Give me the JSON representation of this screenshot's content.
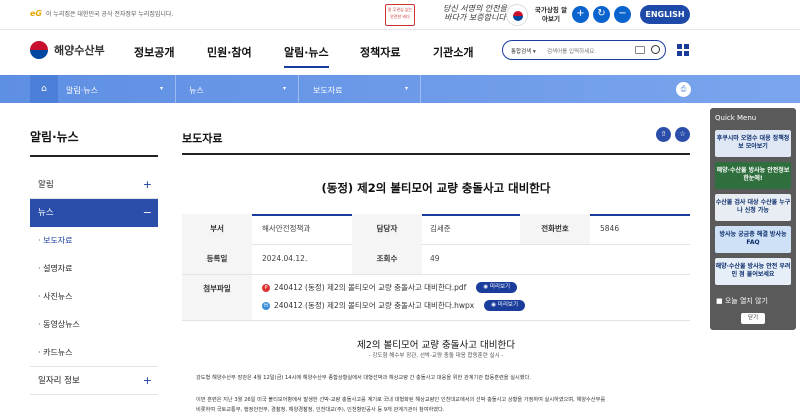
{
  "topbar": {
    "gov_logo": "eG",
    "gov_notice": "이 누리집은 대한민국 공식 전자정부 누리집입니다.",
    "banner_text": "말 무관심 없는 안전한 바다",
    "slogan": "당신 서명의 안전을 바다가 보증합니다",
    "flag_label": "국가상징 알아보기",
    "english_label": "ENGLISH"
  },
  "header": {
    "org_name": "해양수산부",
    "nav": [
      "정보공개",
      "민원·참여",
      "알림·뉴스",
      "정책자료",
      "기관소개"
    ],
    "search_scope": "통합검색 ▾",
    "search_placeholder": "검색어를 입력하세요."
  },
  "breadcrumb": {
    "home_icon": "home-icon",
    "items": [
      "알림·뉴스",
      "뉴스",
      "보도자료"
    ]
  },
  "lnb": {
    "title": "알림·뉴스",
    "items": [
      {
        "label": "알림",
        "toggle": "+"
      },
      {
        "label": "뉴스",
        "toggle": "−"
      }
    ],
    "subitems": [
      "· 보도자료",
      "· 설명자료",
      "· 사진뉴스",
      "· 동영상뉴스",
      "· 카드뉴스"
    ],
    "items_after": [
      {
        "label": "일자리 정보",
        "toggle": "+"
      }
    ]
  },
  "main": {
    "title": "보도자료",
    "article_title": "(동정) 제2의 볼티모어 교량 충돌사고 대비한다",
    "info_rows": [
      {
        "l1": "부서",
        "v1": "해사안전정책과",
        "l2": "담당자",
        "v2": "김세준",
        "l3": "전화번호",
        "v3": "5846"
      },
      {
        "l1": "등록일",
        "v1": "2024.04.12.",
        "l2": "조회수",
        "v2": "49",
        "l3": "",
        "v3": ""
      }
    ],
    "attach_label": "첨부파일",
    "files": [
      {
        "name": "240412 (동정) 제2의 볼티모어 교량 충돌사고 대비한다.pdf",
        "preview": "◉ 미리보기",
        "color": "#d33"
      },
      {
        "name": "240412 (동정) 제2의 볼티모어 교량 충돌사고 대비한다.hwpx",
        "preview": "◉ 미리보기",
        "color": "#3a8ed8"
      }
    ],
    "body_title": "제2의 볼티모어 교량 충돌사고 대비한다",
    "body_subtitle": "- 강도형 해수부 장관, 선박-교량 충돌 대응 합동훈련 실시 -",
    "paragraphs": [
      "강도형 해양수산부 장관은 4월 12일(금) 14시에 해양수산부 종합상황실에서 대형선박과 해상교량 간 충돌사고 대응을 위한 관계기관 합동훈련을 실시했다.",
      "이번 훈련은 지난 3월 26일 미국 볼티모어항에서 발생한 선박-교량 충돌사고를 계기로 국내 대형화된 해상교량인 인천대교에서의 선박 충돌사고 상황을 가정하여 실시하였으며, 해양수산부를",
      "비롯하여 국토교통부, 행정안전부, 경찰청, 해양경찰청, 인천대교(주), 인천항만공사 등 9개 관계기관이 참여하였다."
    ]
  },
  "quick_menu": {
    "title": "Quick Menu",
    "cards": [
      {
        "text": "후쿠시마 오염수 대응 정책정보 모아보기",
        "bg": "#dfe7f5"
      },
      {
        "text": "해양·수산물 방사능 안전정보 한눈에!",
        "bg": "#2f6f3d"
      },
      {
        "text": "수산물 검사 대상 수산물 누구나 신청 가능",
        "bg": "#e8edf3"
      },
      {
        "text": "방사능 궁금증 해결 방사능 FAQ",
        "bg": "#cfe1f6"
      },
      {
        "text": "해양·수산물 방사능 안전 우려인 점 물어보세요",
        "bg": "#e6eef8"
      }
    ],
    "checkbox_label": "■ 오늘 열지 않기",
    "close_label": "닫기"
  }
}
